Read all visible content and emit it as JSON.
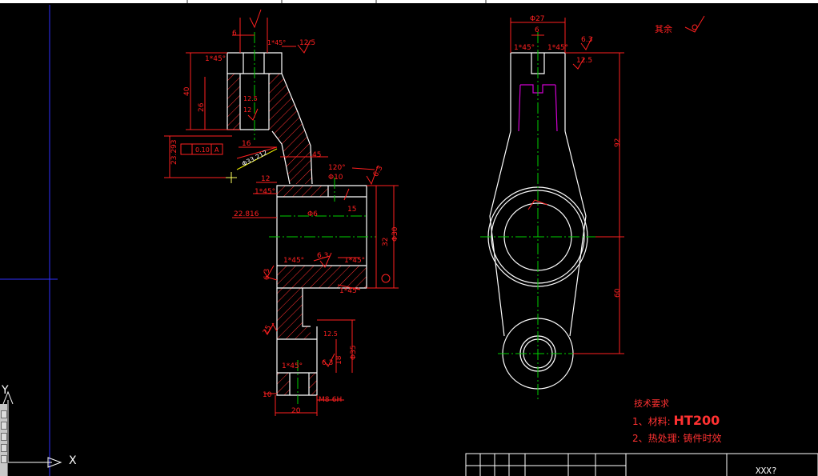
{
  "axes": {
    "x_label": "X",
    "y_label": "Y"
  },
  "roughness_note": "其余",
  "left_view": {
    "dims": [
      "6",
      "1*45°",
      "12.5",
      "1*45°",
      "40",
      "26",
      "12.5",
      "12",
      "16",
      "23.293",
      "0.10",
      "A",
      "Φ33.212",
      "45",
      "120°",
      "Φ10",
      "6.3",
      "12",
      "1*45°",
      "22.816",
      "Φ6",
      "15",
      "32",
      "Φ30",
      "1*45°",
      "6.3",
      "1*45°",
      "1*45°",
      "6.3",
      "25",
      "12.5",
      "1*45°",
      "Φ35",
      "6.3",
      "18",
      "10",
      "M8-6H",
      "20"
    ]
  },
  "right_view": {
    "dims": [
      "Φ27",
      "6",
      "1*45°",
      "1*45°",
      "6.3",
      "12.5",
      "92",
      "60"
    ]
  },
  "tech_requirements": {
    "heading": "技术要求",
    "item1_prefix": "1、材料:",
    "item1_value": "HT200",
    "item2": "2、热处理: 铸件时效"
  },
  "title_block": {
    "part_name": "XXX?"
  },
  "colors": {
    "outline": "#ffffff",
    "dimension": "#ff2020",
    "center": "#00d000",
    "hatch": "#ff3030",
    "feature": "#d000d0",
    "ucs": "#3030ff"
  }
}
